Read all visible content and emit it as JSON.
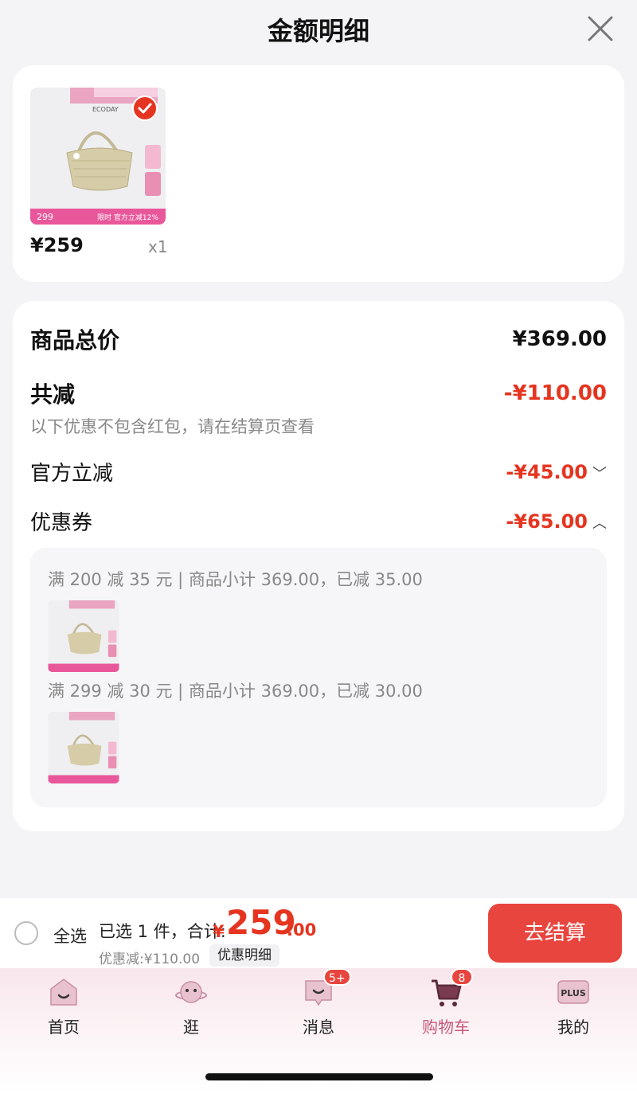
{
  "header": {
    "title": "金额明细"
  },
  "item": {
    "price": "¥259",
    "qty": "x1",
    "thumb_caption_left": "299",
    "thumb_caption_right": "限时 官方立减12%",
    "thumb_brand": "ECODAY"
  },
  "summary": {
    "total_label": "商品总价",
    "total_value": "¥369.00",
    "reduce_label": "共减",
    "reduce_value": "-¥110.00",
    "note": "以下优惠不包含红包，请在结算页查看",
    "official_label": "官方立减",
    "official_value": "-¥45.00",
    "coupon_label": "优惠券",
    "coupon_value": "-¥65.00"
  },
  "coupons": [
    {
      "text": "满 200 减 35 元 | 商品小计 369.00，已减 35.00"
    },
    {
      "text": "满 299 减 30 元 | 商品小计 369.00，已减 30.00"
    }
  ],
  "bottom": {
    "select_all": "全选",
    "selected": "已选 1 件，合计:",
    "total_yen": "¥",
    "total_int": "259",
    "total_dec": ".00",
    "discount": "优惠减:¥110.00",
    "detail_btn": "优惠明细",
    "checkout": "去结算"
  },
  "tabs": [
    {
      "label": "首页",
      "icon": "home-icon"
    },
    {
      "label": "逛",
      "icon": "planet-icon"
    },
    {
      "label": "消息",
      "icon": "message-icon",
      "badge": "5+"
    },
    {
      "label": "购物车",
      "icon": "cart-icon",
      "badge": "8",
      "active": true
    },
    {
      "label": "我的",
      "icon": "plus-member-icon",
      "icon_text": "PLUS"
    }
  ],
  "colors": {
    "accent": "#e5341f",
    "checkout": "#e8453e",
    "active_tab": "#c9587a"
  }
}
